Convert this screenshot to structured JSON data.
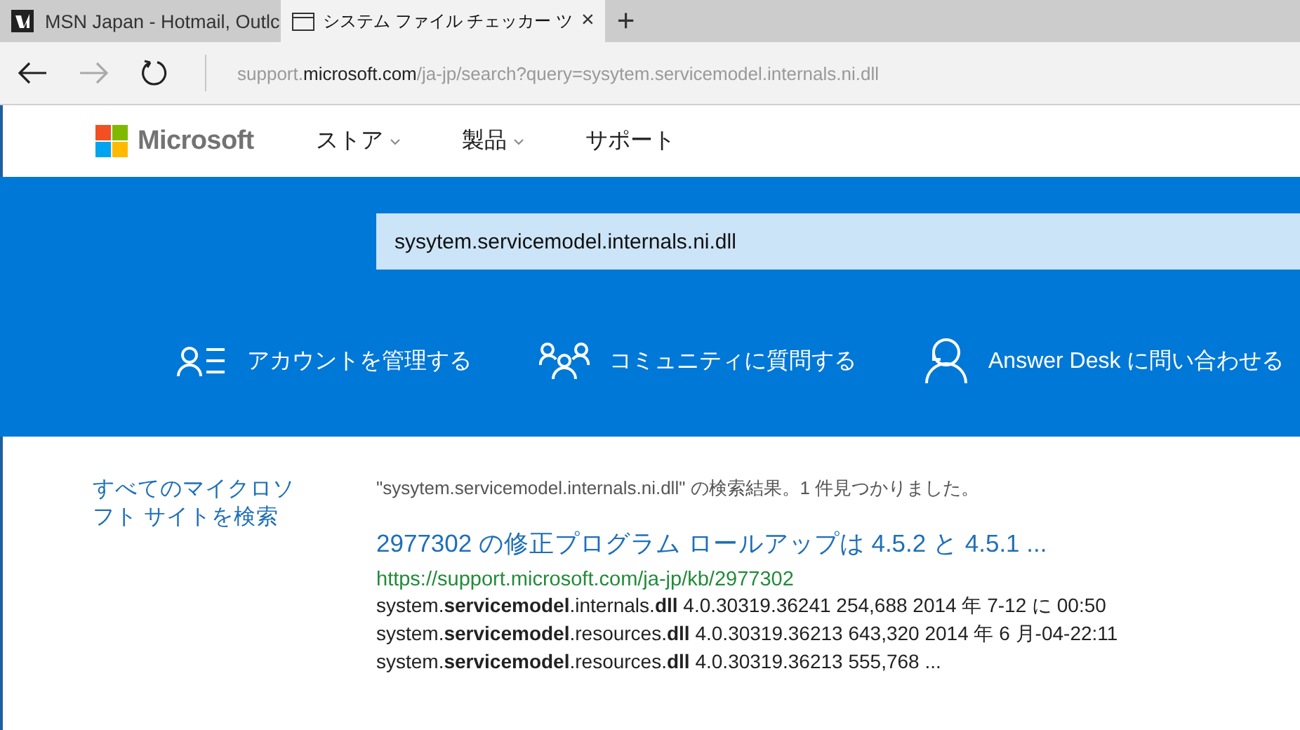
{
  "tabs": [
    {
      "label": "MSN Japan - Hotmail, Outlc",
      "kind": "msn",
      "selected": false
    },
    {
      "label": "システム ファイル チェッカー ツ",
      "kind": "page",
      "selected": true,
      "close": "×"
    }
  ],
  "new_tab": "+",
  "address": {
    "prefix": "support.",
    "domain": "microsoft.com",
    "path": "/ja-jp/search?query=sysytem.servicemodel.internals.ni.dll"
  },
  "header": {
    "logo": "Microsoft",
    "nav": [
      {
        "label": "ストア",
        "dropdown": true
      },
      {
        "label": "製品",
        "dropdown": true
      },
      {
        "label": "サポート",
        "dropdown": false
      }
    ]
  },
  "search": {
    "value": "sysytem.servicemodel.internals.ni.dll"
  },
  "actions": [
    {
      "label": "アカウントを管理する",
      "kind": "account"
    },
    {
      "label": "コミュニティに質問する",
      "kind": "community"
    },
    {
      "label": "Answer Desk に問い合わせる",
      "kind": "agent"
    }
  ],
  "sidebar": {
    "link": "すべてのマイクロソフト サイトを検索"
  },
  "results": {
    "summary": "\"sysytem.servicemodel.internals.ni.dll\" の検索結果。1 件見つかりました。",
    "items": [
      {
        "title": "2977302 の修正プログラム ロールアップは 4.5.2 と 4.5.1 ...",
        "url": "https://support.microsoft.com/ja-jp/kb/2977302",
        "lines": [
          "system.**servicemodel**.internals.**dll** 4.0.30319.36241 254,688 2014 年 7-12 に 00:50",
          "system.**servicemodel**.resources.**dll** 4.0.30319.36213 643,320 2014 年 6 月-04-22:11",
          "system.**servicemodel**.resources.**dll** 4.0.30319.36213 555,768 ..."
        ]
      }
    ]
  }
}
